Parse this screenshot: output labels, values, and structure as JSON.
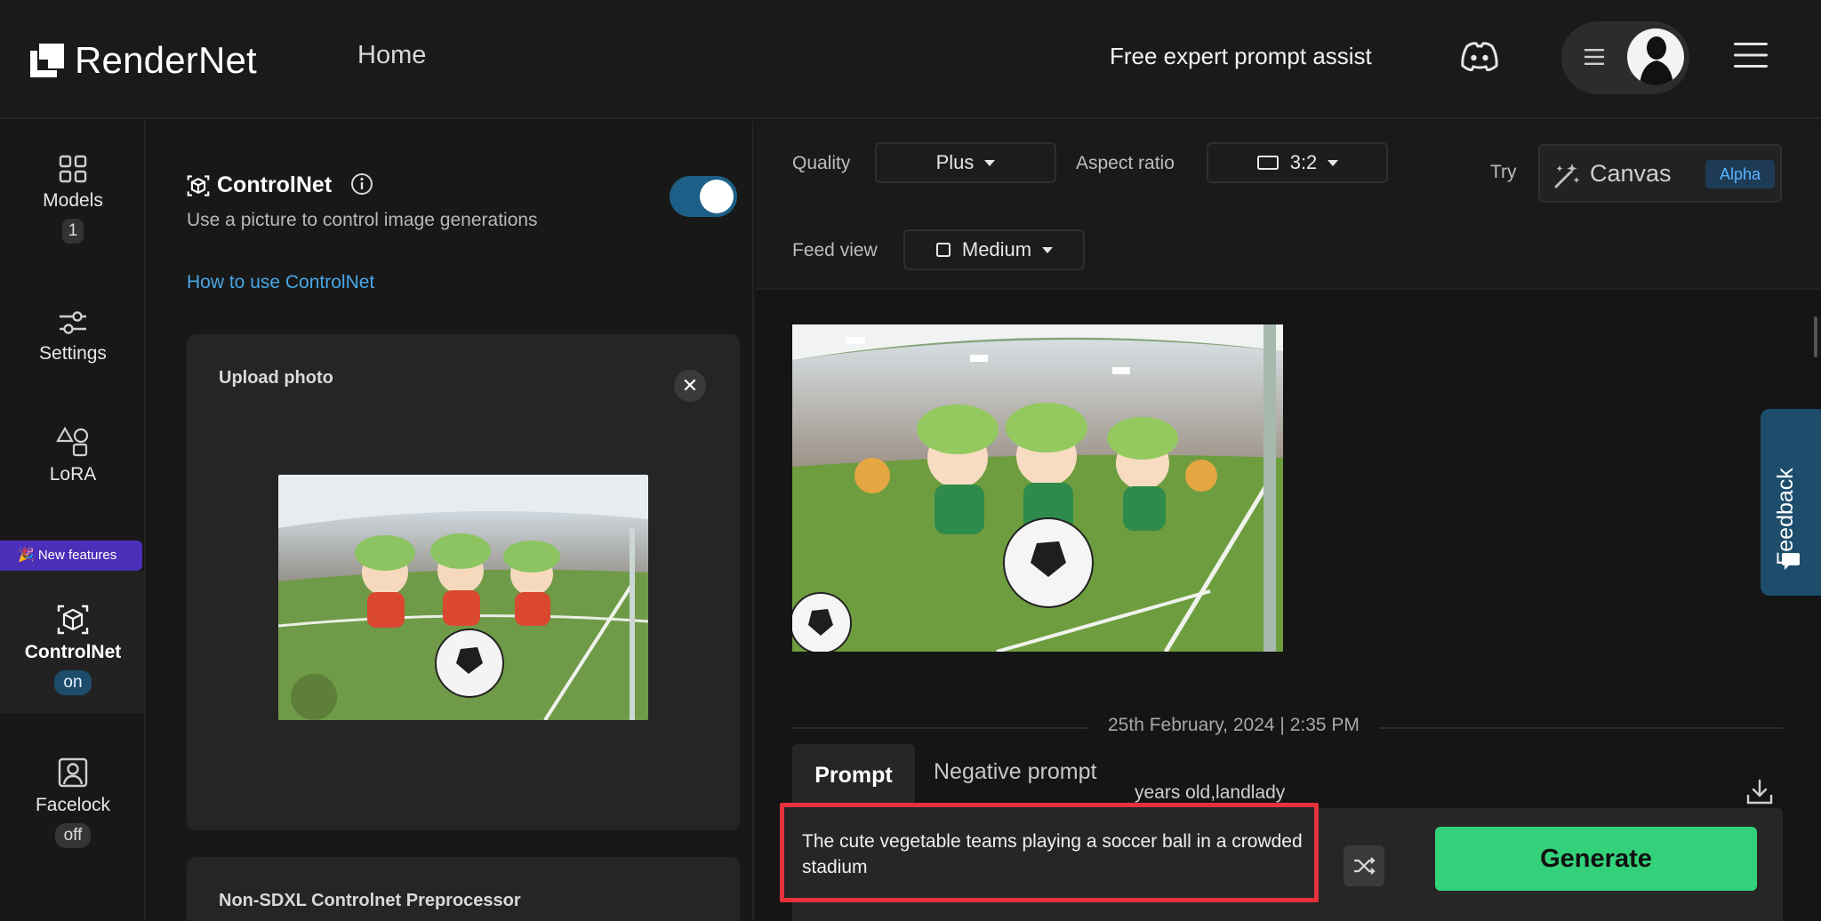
{
  "header": {
    "brand": "RenderNet",
    "home": "Home",
    "prompt_assist": "Free expert prompt assist"
  },
  "rail": {
    "models": {
      "label": "Models",
      "badge": "1"
    },
    "settings": {
      "label": "Settings"
    },
    "lora": {
      "label": "LoRA"
    },
    "new_features": "🎉 New features",
    "controlnet": {
      "label": "ControlNet",
      "badge": "on"
    },
    "facelock": {
      "label": "Facelock",
      "badge": "off"
    }
  },
  "controlnet_panel": {
    "title": "ControlNet",
    "subtitle": "Use a picture to control image generations",
    "enabled": true,
    "howto_link": "How to use ControlNet",
    "upload_title": "Upload photo",
    "close_glyph": "✕",
    "preprocessor_title": "Non-SDXL Controlnet Preprocessor"
  },
  "controls": {
    "quality_label": "Quality",
    "quality_value": "Plus",
    "aspect_label": "Aspect ratio",
    "aspect_value": "3:2",
    "try_label": "Try",
    "canvas_label": "Canvas",
    "canvas_badge": "Alpha",
    "feed_label": "Feed view",
    "feed_value": "Medium"
  },
  "feed": {
    "date": "25th February, 2024 | 2:35 PM",
    "tab_prompt": "Prompt",
    "tab_negative": "Negative prompt",
    "prompt_behind": "years old,landlady"
  },
  "composer": {
    "prompt_text": "The cute vegetable teams playing a soccer ball  in a crowded stadium",
    "generate_label": "Generate"
  },
  "feedback_label": "Feedback",
  "colors": {
    "accent_blue": "#1d5f86",
    "generate_green": "#33d17a",
    "highlight_red": "#e5323b",
    "link_blue": "#48a6e6",
    "new_features_purple": "#4b2fb8"
  }
}
